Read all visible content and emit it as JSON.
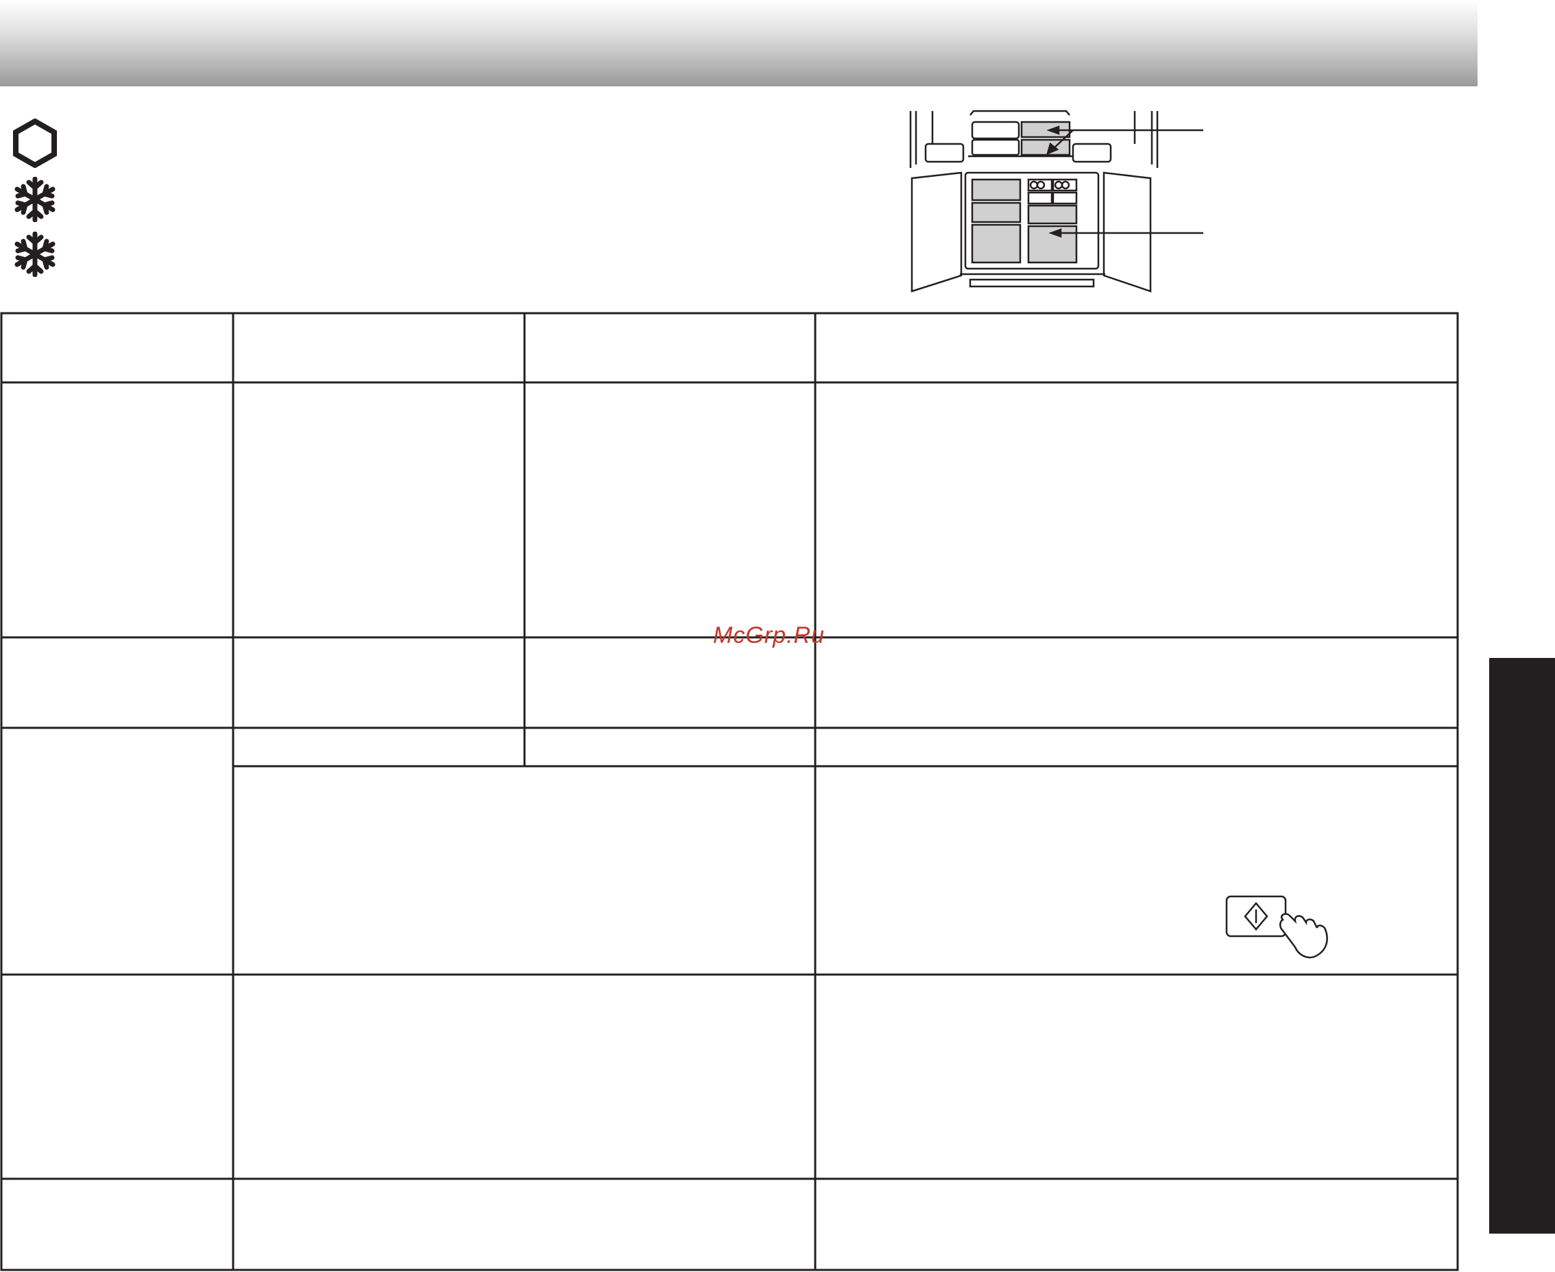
{
  "watermark": {
    "text": "McGrp.Ru"
  },
  "legend_icons": [
    {
      "icon": "hexagon-icon"
    },
    {
      "icon": "snowflake-icon"
    },
    {
      "icon": "snowflake-icon"
    }
  ],
  "illustration": {
    "icon": "refrigerator-interior-diagram"
  },
  "table": {
    "rows": 6,
    "columns": 4,
    "cells": []
  },
  "start_button": {
    "icon": "start-diamond-icon",
    "hand": "pointing-hand-icon"
  },
  "colors": {
    "ink": "#231f20",
    "tab": "#231f20",
    "watermark": "#c0392b"
  }
}
